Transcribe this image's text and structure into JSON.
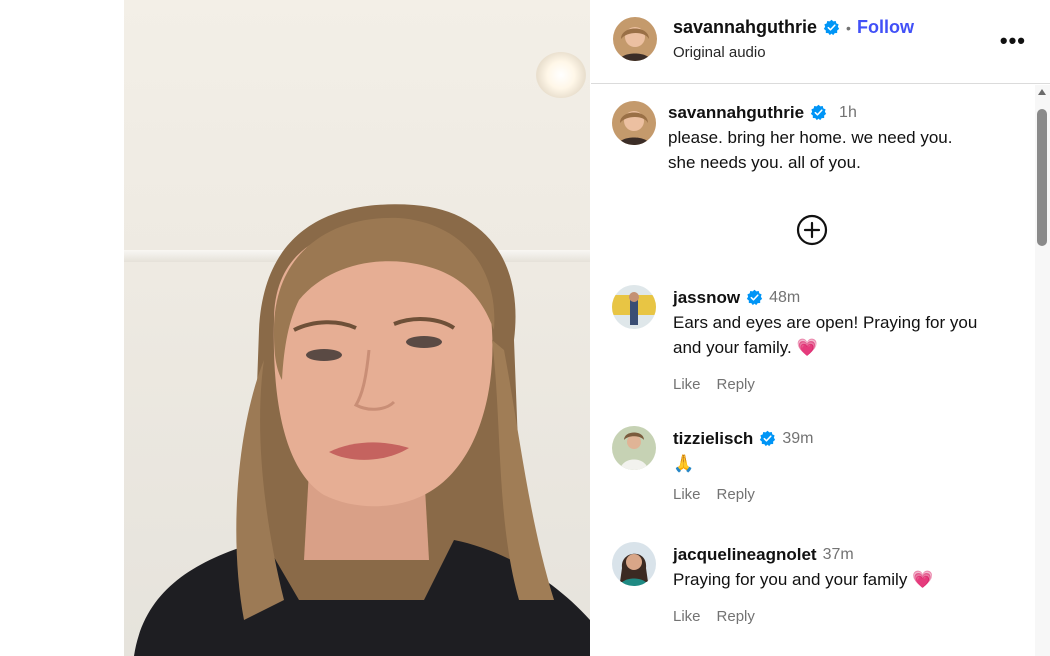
{
  "header": {
    "username": "savannahguthrie",
    "separator": "•",
    "follow_label": "Follow",
    "audio_label": "Original audio",
    "more_label": "•••"
  },
  "caption": {
    "username": "savannahguthrie",
    "time": "1h",
    "text_line1": "please. bring her home. we need you.",
    "text_line2": "she needs you. all of you."
  },
  "comments": [
    {
      "username": "jassnow",
      "time": "48m",
      "line1": "Ears and eyes are open! Praying for you",
      "line2": "and your family. 💗",
      "like_label": "Like",
      "reply_label": "Reply"
    },
    {
      "username": "tizzielisch",
      "time": "39m",
      "line1": "🙏",
      "like_label": "Like",
      "reply_label": "Reply"
    },
    {
      "username": "jacquelineagnolet",
      "time": "37m",
      "line1": "Praying for you and your family 💗",
      "like_label": "Like",
      "reply_label": "Reply"
    }
  ],
  "colors": {
    "follow": "#4150f7",
    "verified": "#0095f6",
    "muted": "#737373"
  }
}
